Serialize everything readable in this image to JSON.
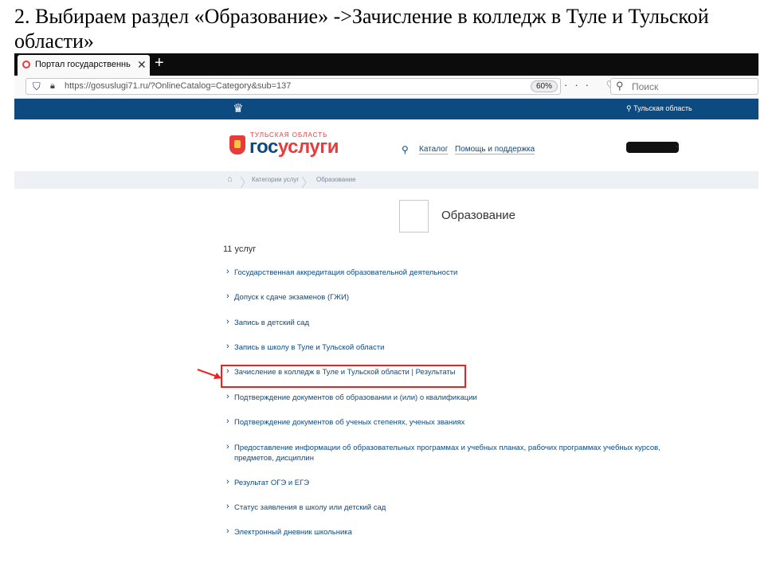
{
  "caption": "2. Выбираем раздел «Образование» ->Зачисление в колледж в Туле и Тульской области»",
  "browser": {
    "tab_title": "Портал государственных усл",
    "tab_close": "✕",
    "new_tab": "+",
    "url": "https://gosuslugi71.ru/?OnlineCatalog=Category&sub=137",
    "zoom": "60%",
    "search_placeholder": "Поиск",
    "nav_icons": "··· ♡ ☆"
  },
  "site": {
    "region": "⚲ Тульская область",
    "logo_region": "ТУЛЬСКАЯ ОБЛАСТЬ",
    "logo_part1": "гос",
    "logo_part2": "услуги",
    "nav": [
      "Каталог",
      "Помощь и поддержка"
    ]
  },
  "breadcrumb": [
    "Категории услуг",
    "Образование"
  ],
  "category": {
    "title": "Образование",
    "count_label": "11 услуг"
  },
  "services": [
    "Государственная аккредитация образовательной деятельности",
    "Допуск к сдаче экзаменов (ГЖИ)",
    "Запись в детский сад",
    "Запись в школу в Туле и Тульской области",
    "Зачисление в колледж в Туле и Тульской области | Результаты",
    "Подтверждение документов об образовании и (или) о квалификации",
    "Подтверждение документов об ученых степенях, ученых званиях",
    "Предоставление информации об образовательных программах и учебных планах, рабочих программах учебных курсов, предметов, дисциплин",
    "Результат ОГЭ и ЕГЭ",
    "Статус заявления в школу или детский сад",
    "Электронный дневник школьника"
  ],
  "colors": {
    "brand_blue": "#0d4a80",
    "brand_red": "#e63c3c",
    "highlight": "#ff1a1a"
  }
}
